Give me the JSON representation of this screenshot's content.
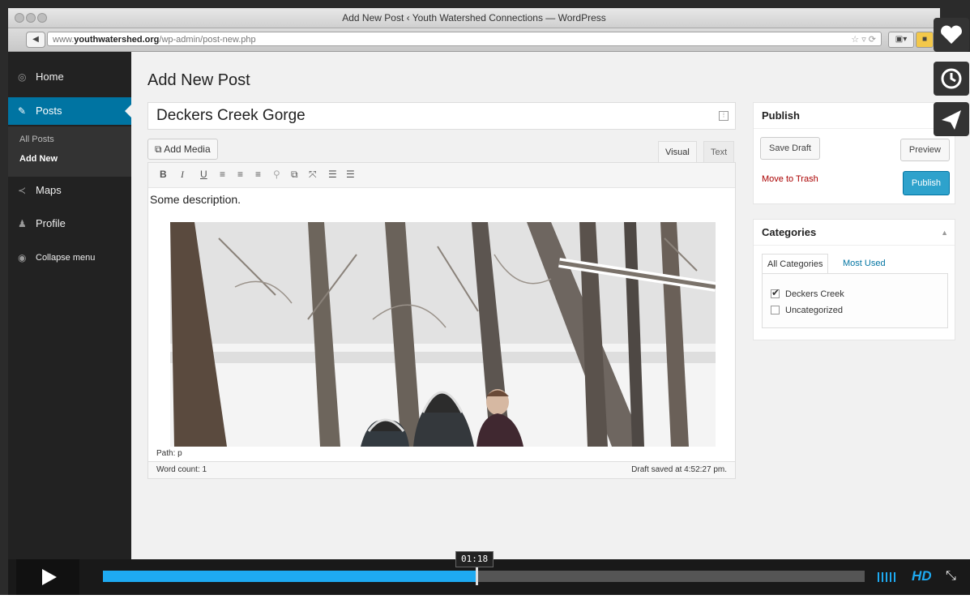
{
  "browser": {
    "window_title": "Add New Post ‹ Youth Watershed Connections — WordPress",
    "url_prefix": "www.",
    "url_domain": "youthwatershed.org",
    "url_path": "/wp-admin/post-new.php"
  },
  "sidebar": {
    "items": [
      {
        "label": "Home",
        "icon": "dashboard-icon"
      },
      {
        "label": "Posts",
        "icon": "pushpin-icon"
      },
      {
        "label": "Maps",
        "icon": "map-icon"
      },
      {
        "label": "Profile",
        "icon": "user-icon"
      },
      {
        "label": "Collapse menu",
        "icon": "collapse-icon"
      }
    ],
    "submenu": [
      {
        "label": "All Posts"
      },
      {
        "label": "Add New"
      }
    ],
    "active_color": "#0074a2"
  },
  "main": {
    "page_title": "Add New Post",
    "post_title": "Deckers Creek Gorge",
    "add_media_label": "Add Media",
    "tab_visual": "Visual",
    "tab_text": "Text",
    "description": "Some description.",
    "path": "Path: p",
    "word_count": "Word count: 1",
    "draft_saved": "Draft saved at 4:52:27 pm."
  },
  "publish": {
    "title": "Publish",
    "save_draft": "Save Draft",
    "preview": "Preview",
    "move_to_trash": "Move to Trash",
    "publish_button": "Publish"
  },
  "categories": {
    "title": "Categories",
    "tab_all": "All Categories",
    "tab_most_used": "Most Used",
    "items": [
      {
        "label": "Deckers Creek",
        "checked": true
      },
      {
        "label": "Uncategorized",
        "checked": false
      }
    ]
  },
  "video_player": {
    "timestamp": "01:18",
    "progress_fraction": 0.49,
    "hd_label": "HD",
    "accent": "#1eaaf1"
  }
}
